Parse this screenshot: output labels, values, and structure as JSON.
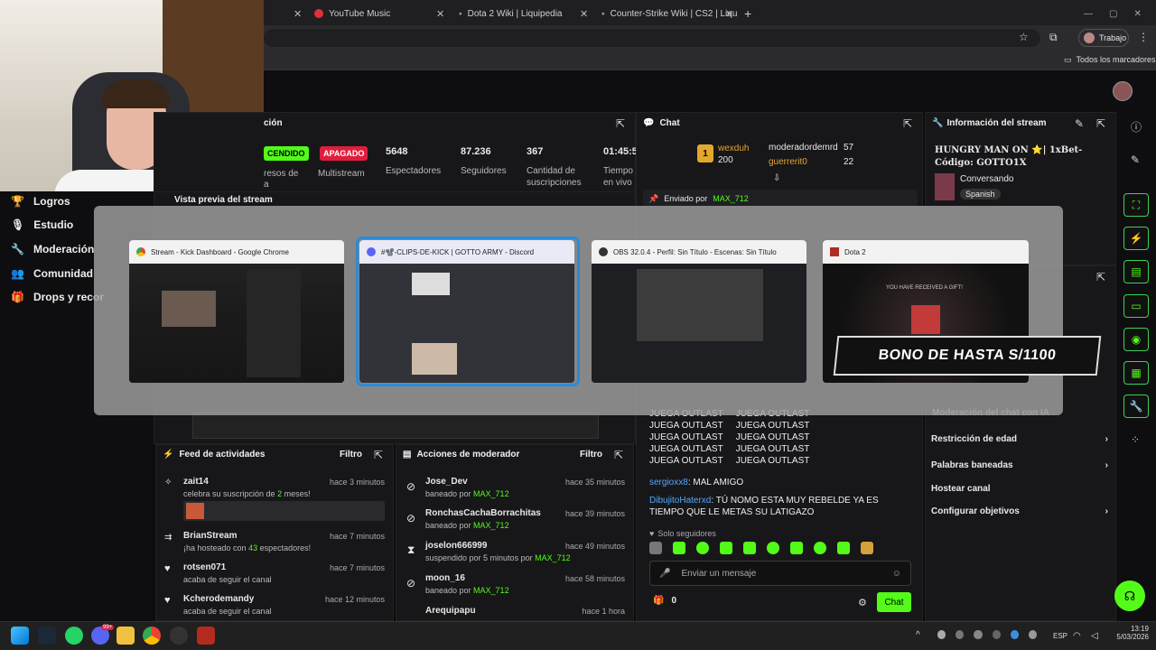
{
  "browser": {
    "tabs": [
      {
        "label": "YouTube Music"
      },
      {
        "label": "Dota 2 Wiki | Liquipedia"
      },
      {
        "label": "Counter-Strike Wiki | CS2 | Liqu"
      }
    ],
    "profile": "Trabajo",
    "bookmarks_all": "Todos los marcadores"
  },
  "sidebar": {
    "items": [
      {
        "label": "Logros"
      },
      {
        "label": "Estudio"
      },
      {
        "label": "Moderación"
      },
      {
        "label": "Comunidad"
      },
      {
        "label": "Drops y recor"
      }
    ]
  },
  "stats": {
    "title": "ción",
    "status_on": "CENDIDO",
    "status_off": "APAGADO",
    "label_1": "resos de",
    "label_1b": "a",
    "multistream": "Multistream",
    "viewers": "5648",
    "viewers_label": "Espectadores",
    "followers": "87.236",
    "followers_label": "Seguidores",
    "subs": "367",
    "subs_label_1": "Cantidad de",
    "subs_label_2": "suscripciones",
    "time": "01:45:5",
    "time_label_1": "Tiempo",
    "time_label_2": "en vivo"
  },
  "preview": {
    "title": "Vista previa del stream"
  },
  "chat": {
    "title": "Chat",
    "leaders": [
      {
        "rank": "1",
        "name": "wexduh",
        "count": "200"
      },
      {
        "name": "moderadordemrd",
        "count": "57"
      },
      {
        "name": "guerrerit0",
        "count": "22"
      }
    ],
    "pinned_by": "Enviado por",
    "pinned_user": "MAX_712",
    "spam_prefix": "JUEGA OUTLAST",
    "msg1_user": "sergioxx8",
    "msg1_text": ": MAL AMIGO",
    "msg2_user": "DibujitoHaterxd",
    "msg2_text": ": TÚ NOMO ESTA MUY REBELDE YA ES TIEMPO QUE LE METAS SU LATIGAZO",
    "followers_only": "Solo seguidores",
    "placeholder": "Enviar un mensaje",
    "count": "0",
    "send": "Chat"
  },
  "info": {
    "title": "Información del stream",
    "stream_title": "HUNGRY MAN ON ⭐| 1xBet- Código: GOTTO1X",
    "category": "Conversando",
    "language": "Spanish"
  },
  "settings": {
    "partial": "Moderación del chat con IA",
    "items": [
      {
        "label": "Restricción de edad"
      },
      {
        "label": "Palabras baneadas"
      },
      {
        "label": "Hostear canal"
      },
      {
        "label": "Configurar objetivos"
      }
    ]
  },
  "activity": {
    "title": "Feed de actividades",
    "filter": "Filtro",
    "items": [
      {
        "user": "zait14",
        "time": "hace 3 minutos",
        "text_a": "celebra su suscripción de ",
        "num": "2",
        "text_b": " meses!"
      },
      {
        "user": "BrianStream",
        "time": "hace 7 minutos",
        "text_a": "¡ha hosteado con ",
        "num": "43",
        "text_b": " espectadores!"
      },
      {
        "user": "rotsen071",
        "time": "hace 7 minutos",
        "text_a": "acaba de seguir el canal",
        "num": "",
        "text_b": ""
      },
      {
        "user": "Kcherodemandy",
        "time": "hace 12 minutos",
        "text_a": "acaba de seguir el canal",
        "num": "",
        "text_b": ""
      }
    ]
  },
  "modactions": {
    "title": "Acciones de moderador",
    "filter": "Filtro",
    "items": [
      {
        "user": "Jose_Dev",
        "time": "hace 35 minutos",
        "text": "baneado por ",
        "by": "MAX_712"
      },
      {
        "user": "RonchasCachaBorrachitas",
        "time": "hace 39 minutos",
        "text": "baneado por ",
        "by": "MAX_712"
      },
      {
        "user": "joselon666999",
        "time": "hace 49 minutos",
        "text": "suspendido por 5 minutos por ",
        "by": "MAX_712"
      },
      {
        "user": "moon_16",
        "time": "hace 58 minutos",
        "text": "baneado por ",
        "by": "MAX_712"
      },
      {
        "user": "Arequipapu",
        "time": "hace 1 hora",
        "text": "",
        "by": ""
      }
    ]
  },
  "alttab": {
    "windows": [
      {
        "title": "Stream - Kick Dashboard - Google Chrome"
      },
      {
        "title": "#📽️-CLIPS-DE-KICK | GOTTO ARMY - Discord"
      },
      {
        "title": "OBS 32.0.4 - Perfil: Sin Título - Escenas: Sin Título"
      },
      {
        "title": "Dota 2"
      }
    ],
    "gift_text": "YOU HAVE RECEIVED A GIFT!"
  },
  "overlay": {
    "bonus": "BONO DE HASTA S/1100"
  },
  "taskbar": {
    "lang": "ESP",
    "time": "13:19",
    "date": "5/03/2026",
    "badge": "99+"
  },
  "colors": {
    "accent": "#53fc18",
    "danger": "#e01e3c"
  }
}
